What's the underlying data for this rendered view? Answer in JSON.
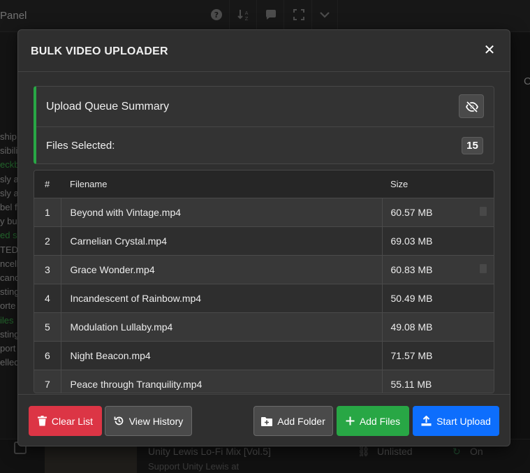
{
  "background": {
    "app_title": "Panel",
    "toolbar_icons": [
      "help-icon",
      "sort-icon",
      "chat-icon",
      "fullscreen-icon",
      "chevron-down-icon"
    ],
    "side_text_lines": [
      {
        "text": "ship f",
        "green": false
      },
      {
        "text": "sibili",
        "green": false
      },
      {
        "text": "eckb",
        "green": true
      },
      {
        "text": "sly a",
        "green": false
      },
      {
        "text": "sly a",
        "green": false
      },
      {
        "text": "bel f",
        "green": false
      },
      {
        "text": "y bu",
        "green": false
      },
      {
        "text": "ed s",
        "green": true
      },
      {
        "text": "TED",
        "green": false
      },
      {
        "text": "ncell",
        "green": false
      },
      {
        "text": "canc",
        "green": false
      },
      {
        "text": "sting",
        "green": false
      },
      {
        "text": "orte",
        "green": false
      },
      {
        "text": "iles",
        "green": true
      },
      {
        "text": "sting",
        "green": false
      },
      {
        "text": "port",
        "green": false
      },
      {
        "text": "elled",
        "green": false
      }
    ],
    "right_partial_text": "C",
    "video_row": {
      "title": "Unity Lewis Lo-Fi Mix [Vol.5]",
      "subtitle": "Support Unity Lewis at",
      "visibility": "Unlisted",
      "toggle_state": "On"
    }
  },
  "modal": {
    "title": "BULK VIDEO UPLOADER",
    "close_symbol": "✕",
    "summary": {
      "title": "Upload Queue Summary",
      "files_selected_label": "Files Selected:",
      "files_selected_count": "15"
    },
    "table": {
      "headers": [
        "#",
        "Filename",
        "Size"
      ],
      "rows": [
        {
          "num": "1",
          "filename": "Beyond with Vintage.mp4",
          "size": "60.57 MB"
        },
        {
          "num": "2",
          "filename": "Carnelian Crystal.mp4",
          "size": "69.03 MB"
        },
        {
          "num": "3",
          "filename": "Grace Wonder.mp4",
          "size": "60.83 MB"
        },
        {
          "num": "4",
          "filename": "Incandescent of Rainbow.mp4",
          "size": "50.49 MB"
        },
        {
          "num": "5",
          "filename": "Modulation Lullaby.mp4",
          "size": "49.08 MB"
        },
        {
          "num": "6",
          "filename": "Night Beacon.mp4",
          "size": "71.57 MB"
        },
        {
          "num": "7",
          "filename": "Peace through Tranquility.mp4",
          "size": "55.11 MB"
        }
      ]
    },
    "footer": {
      "clear_list": "Clear List",
      "view_history": "View History",
      "add_folder": "Add Folder",
      "add_files": "Add Files",
      "start_upload": "Start Upload"
    }
  },
  "colors": {
    "accent_green": "#28a745",
    "danger_red": "#dc3545",
    "primary_blue": "#0d6efd",
    "modal_bg": "#2f2f2f"
  }
}
